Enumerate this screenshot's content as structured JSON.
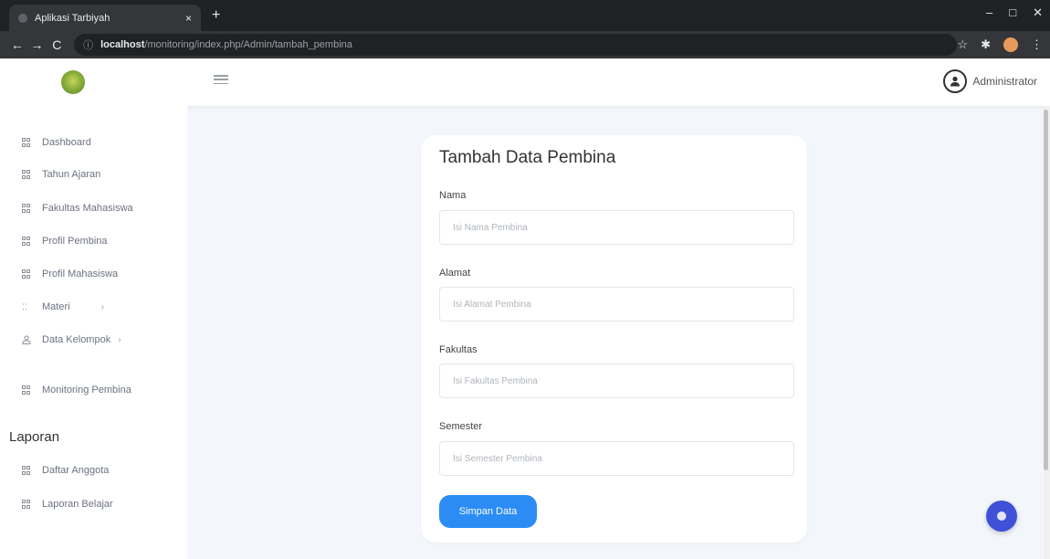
{
  "browser": {
    "tab_title": "Aplikasi Tarbiyah",
    "tab_close": "×",
    "new_tab": "+",
    "url_host": "localhost",
    "url_path": "/monitoring/index.php/Admin/tambah_pembina",
    "url_info_icon": "ⓘ",
    "back_icon": "←",
    "forward_icon": "→",
    "reload_icon": "C",
    "min_icon": "–",
    "max_icon": "□",
    "close_icon": "✕",
    "bookmark_icon": "☆",
    "extension_icon": "✱",
    "menu_icon": "⋮"
  },
  "header": {
    "user_name": "Administrator",
    "user_icon": "user-circle-icon"
  },
  "sidebar": {
    "items": [
      {
        "label": "Dashboard"
      },
      {
        "label": "Tahun Ajaran"
      },
      {
        "label": "Fakultas Mahasiswa"
      },
      {
        "label": "Profil Pembina"
      },
      {
        "label": "Profil Mahasiswa"
      },
      {
        "label": "Materi",
        "chevron": "›"
      },
      {
        "label": "Data Kelompok",
        "chevron": "›"
      },
      {
        "label": "Monitoring Pembina"
      }
    ],
    "section_title": "Laporan",
    "report_items": [
      {
        "label": "Daftar Anggota"
      },
      {
        "label": "Laporan Belajar"
      }
    ]
  },
  "form": {
    "title": "Tambah Data Pembina",
    "fields": [
      {
        "label": "Nama",
        "placeholder": "Isi Nama Pembina",
        "value": ""
      },
      {
        "label": "Alamat",
        "placeholder": "Isi Alamat Pembina",
        "value": ""
      },
      {
        "label": "Fakultas",
        "placeholder": "Isi Fakultas Pembina",
        "value": ""
      },
      {
        "label": "Semester",
        "placeholder": "Isi Semester Pembina",
        "value": ""
      }
    ],
    "submit_label": "Simpan Data"
  },
  "colors": {
    "accent": "#2b8cf5",
    "fab": "#3f51d8",
    "background": "#f3f6fb"
  }
}
